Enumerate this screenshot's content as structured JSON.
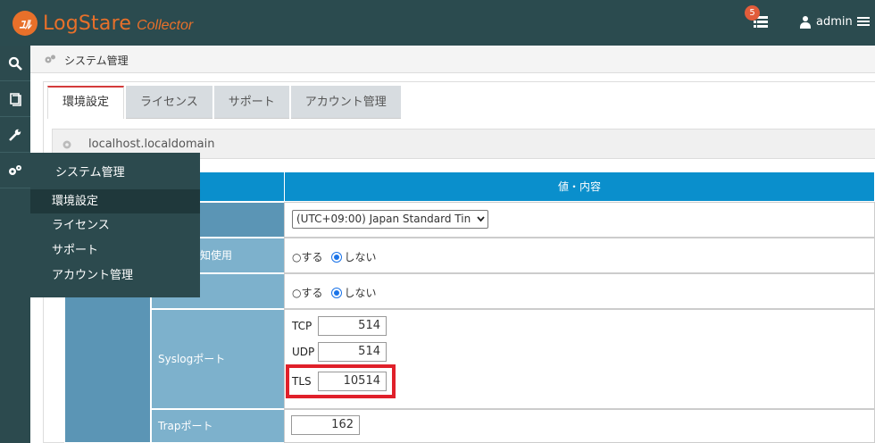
{
  "app": {
    "logo_mark": "ﾕﾙ",
    "name": "LogStare",
    "subtitle": "Collector"
  },
  "header": {
    "notification_count": "5",
    "user": "admin"
  },
  "breadcrumb": "システム管理",
  "tabs": [
    {
      "label": "環境設定",
      "active": true
    },
    {
      "label": "ライセンス"
    },
    {
      "label": "サポート"
    },
    {
      "label": "アカウント管理"
    }
  ],
  "host": "localhost.localdomain",
  "table": {
    "header_value": "値・内容",
    "timezone": "(UTC+09:00) Japan Standard Tin",
    "row2_label": "知使用",
    "radio_yes": "○する",
    "radio_no": "しない",
    "syslog_label": "Syslogポート",
    "trap_label": "Trapポート",
    "ports": {
      "tcp_label": "TCP",
      "tcp": "514",
      "udp_label": "UDP",
      "udp": "514",
      "tls_label": "TLS",
      "tls": "10514",
      "trap": "162"
    }
  },
  "flyout": {
    "title": "システム管理",
    "items": [
      "環境設定",
      "ライセンス",
      "サポート",
      "アカウント管理"
    ]
  },
  "colors": {
    "header_bg": "#2b4b4f",
    "accent": "#e8702a",
    "table_header": "#0a8fcc",
    "highlight": "#e0202a"
  }
}
